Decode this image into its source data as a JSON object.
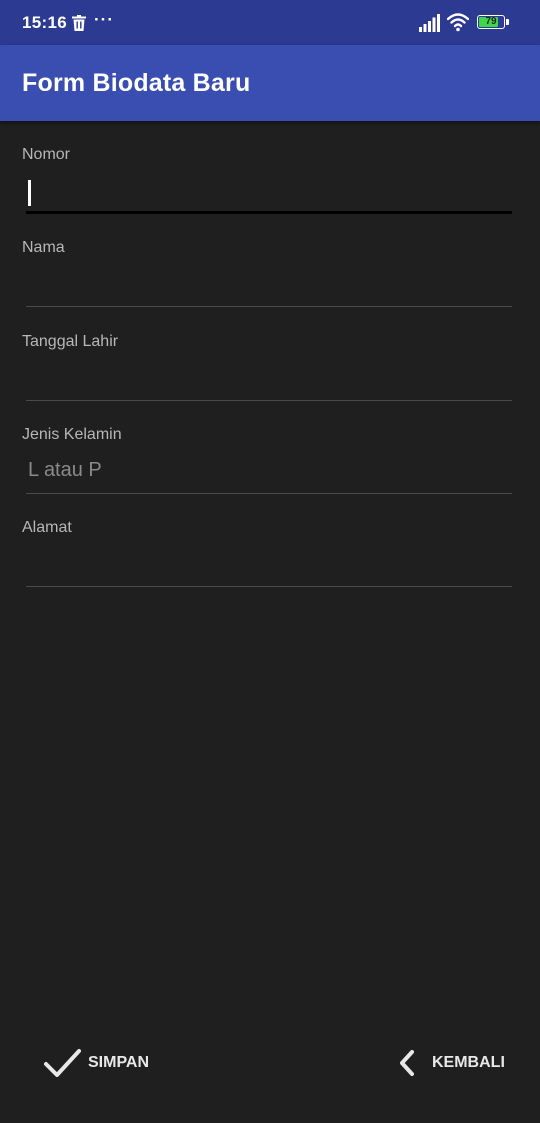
{
  "status_bar": {
    "time": "15:16",
    "more": "···",
    "battery_level": "79",
    "battery_fraction": 0.79,
    "battery_color": "#3fd64a",
    "icons": [
      "trash-icon",
      "more-dots-icon",
      "signal-icon",
      "wifi-icon",
      "battery-icon"
    ]
  },
  "app_bar": {
    "title": "Form Biodata Baru",
    "color": "#3a4db0",
    "status_color": "#2c3a91"
  },
  "form": {
    "fields": [
      {
        "label": "Nomor",
        "value": "",
        "placeholder": "",
        "focused": true
      },
      {
        "label": "Nama",
        "value": "",
        "placeholder": ""
      },
      {
        "label": "Tanggal Lahir",
        "value": "",
        "placeholder": ""
      },
      {
        "label": "Jenis Kelamin",
        "value": "",
        "placeholder": "L atau P"
      },
      {
        "label": "Alamat",
        "value": "",
        "placeholder": ""
      }
    ]
  },
  "actions": {
    "save_label": "SIMPAN",
    "save_icon": "check-icon",
    "back_label": "KEMBALI",
    "back_icon": "chevron-left-icon"
  },
  "theme": {
    "background": "#1f1f1f"
  }
}
